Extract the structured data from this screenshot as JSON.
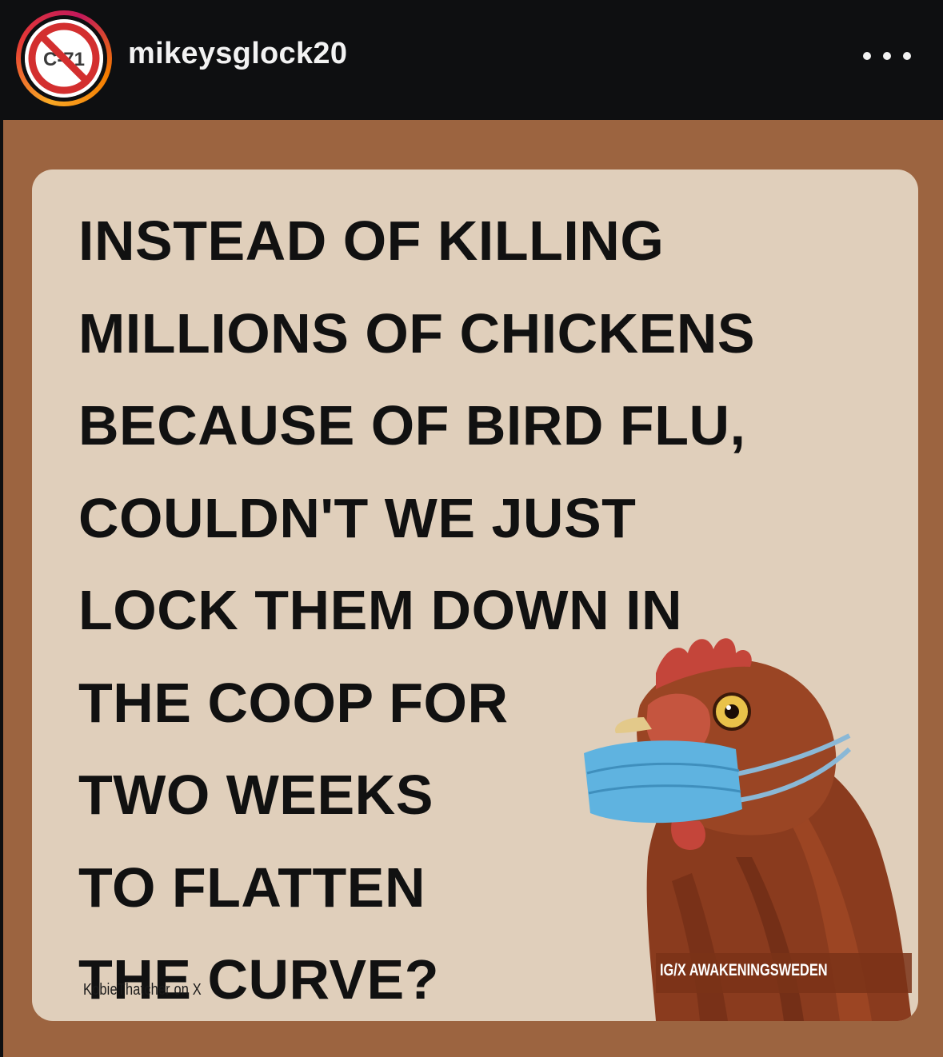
{
  "header": {
    "username": "mikeysglock20",
    "avatar_badge_text": "C-71",
    "more_icon": "ellipsis-icon"
  },
  "post": {
    "headline_lines": [
      "INSTEAD OF KILLING",
      "MILLIONS OF CHICKENS",
      "BECAUSE OF BIRD FLU,",
      "COULDN'T WE JUST",
      "LOCK THEM DOWN IN",
      "THE COOP FOR",
      "TWO WEEKS",
      "TO FLATTEN",
      "THE CURVE?"
    ],
    "credit_left": "KobieThatcher on X",
    "credit_right": "IG/X AWAKENINGSWEDEN"
  },
  "colors": {
    "header_bg": "#0e0f11",
    "post_border": "#9c6440",
    "card_bg": "#e0cfbb",
    "text": "#111111",
    "mask": "#5fb3e0",
    "hen_feather": "#8a3b1e"
  }
}
